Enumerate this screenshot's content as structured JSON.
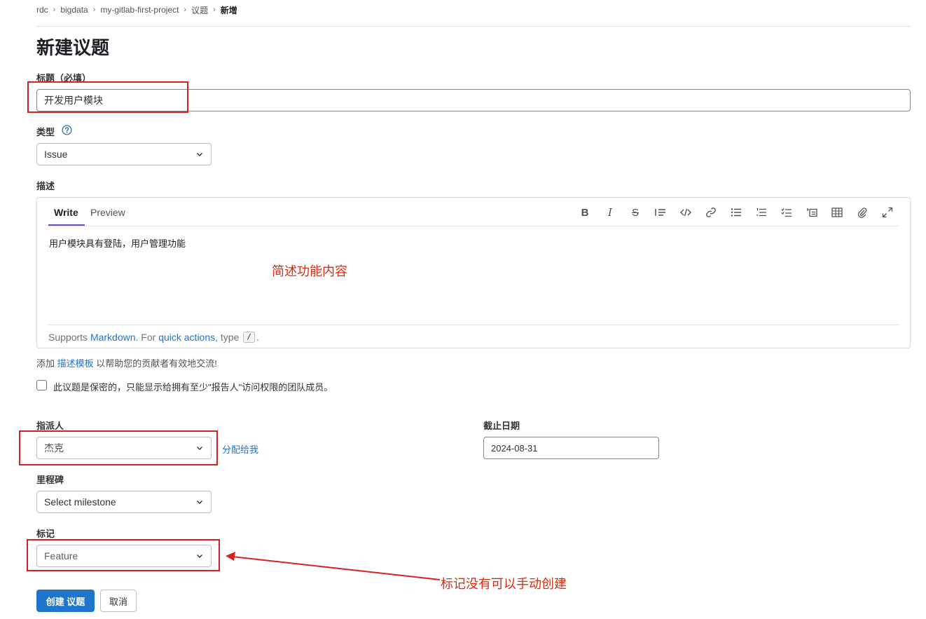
{
  "breadcrumb": [
    "rdc",
    "bigdata",
    "my-gitlab-first-project",
    "议题",
    "新增"
  ],
  "page_title": "新建议题",
  "title_field": {
    "label": "标题（必填）",
    "value": "开发用户模块"
  },
  "type_field": {
    "label": "类型",
    "value": "Issue",
    "help_icon": "question-circle-icon"
  },
  "description": {
    "label": "描述",
    "tabs": [
      "Write",
      "Preview"
    ],
    "toolbar": [
      "bold-icon",
      "italic-icon",
      "strikethrough-icon",
      "quote-icon",
      "code-icon",
      "link-icon",
      "bullet-list-icon",
      "numbered-list-icon",
      "task-list-icon",
      "collapsible-section-icon",
      "table-icon",
      "attach-file-icon",
      "fullscreen-icon"
    ],
    "content": "用户模块具有登陆，用户管理功能",
    "footer": {
      "prefix": "Supports",
      "markdown_link": "Markdown",
      "middle": ". For",
      "quick_actions_link": "quick actions",
      "type_text": ", type",
      "kbd": "/",
      "suffix": "."
    }
  },
  "template_hint": {
    "prefix": "添加",
    "link": "描述模板",
    "suffix": "以帮助您的贡献者有效地交流!"
  },
  "confidential": {
    "checked": false,
    "label": "此议题是保密的，只能显示给拥有至少\"报告人\"访问权限的团队成员。"
  },
  "assignee": {
    "label": "指派人",
    "value": "杰克",
    "assign_me": "分配给我"
  },
  "due_date": {
    "label": "截止日期",
    "value": "2024-08-31"
  },
  "milestone": {
    "label": "里程碑",
    "value": "Select milestone"
  },
  "labels": {
    "label": "标记",
    "value": "Feature"
  },
  "buttons": {
    "create": "创建 议题",
    "cancel": "取消"
  },
  "annotations": {
    "description_note": "简述功能内容",
    "labels_note": "标记没有可以手动创建"
  },
  "colors": {
    "accent": "#1f75cb",
    "annotation_red": "#d82222",
    "tab_underline": "#6e49cb"
  }
}
